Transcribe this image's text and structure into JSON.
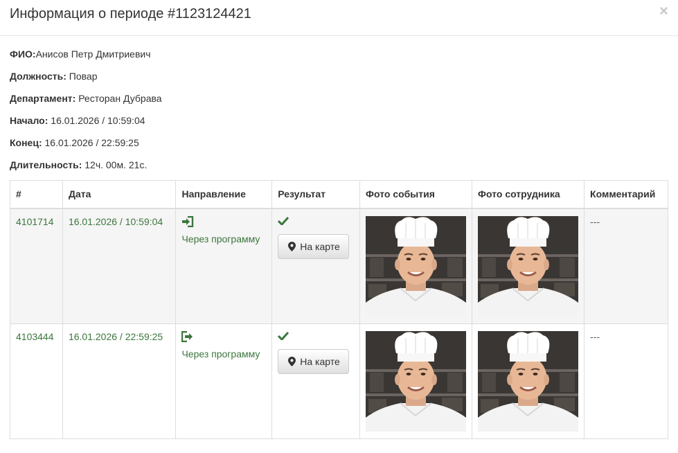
{
  "modal": {
    "title": "Информация о периоде #1123124421",
    "close": "×"
  },
  "info": {
    "fio_label": "ФИО:",
    "fio_value": "Анисов Петр Дмитриевич",
    "position_label": "Должность:",
    "position_value": "Повар",
    "department_label": "Департамент:",
    "department_value": "Ресторан Дубрава",
    "start_label": "Начало:",
    "start_value": "16.01.2026 / 10:59:04",
    "end_label": "Конец:",
    "end_value": "16.01.2026 / 22:59:25",
    "duration_label": "Длительность:",
    "duration_value": "12ч. 00м. 21с."
  },
  "table": {
    "headers": [
      "#",
      "Дата",
      "Направление",
      "Результат",
      "Фото события",
      "Фото сотрудника",
      "Комментарий"
    ],
    "rows": [
      {
        "id": "4101714",
        "date": "16.01.2026 / 10:59:04",
        "direction_icon": "sign-in-icon",
        "direction_text": "Через программу",
        "result_icon": "checkmark-icon",
        "map_button": "На карте",
        "event_photo": "chef-portrait",
        "employee_photo": "chef-portrait",
        "comment": "---"
      },
      {
        "id": "4103444",
        "date": "16.01.2026 / 22:59:25",
        "direction_icon": "sign-out-icon",
        "direction_text": "Через программу",
        "result_icon": "checkmark-icon",
        "map_button": "На карте",
        "event_photo": "chef-portrait",
        "employee_photo": "chef-portrait",
        "comment": "---"
      }
    ]
  },
  "colors": {
    "green": "#3c763d",
    "border": "#dddddd",
    "row_bg": "#f5f5f5"
  }
}
